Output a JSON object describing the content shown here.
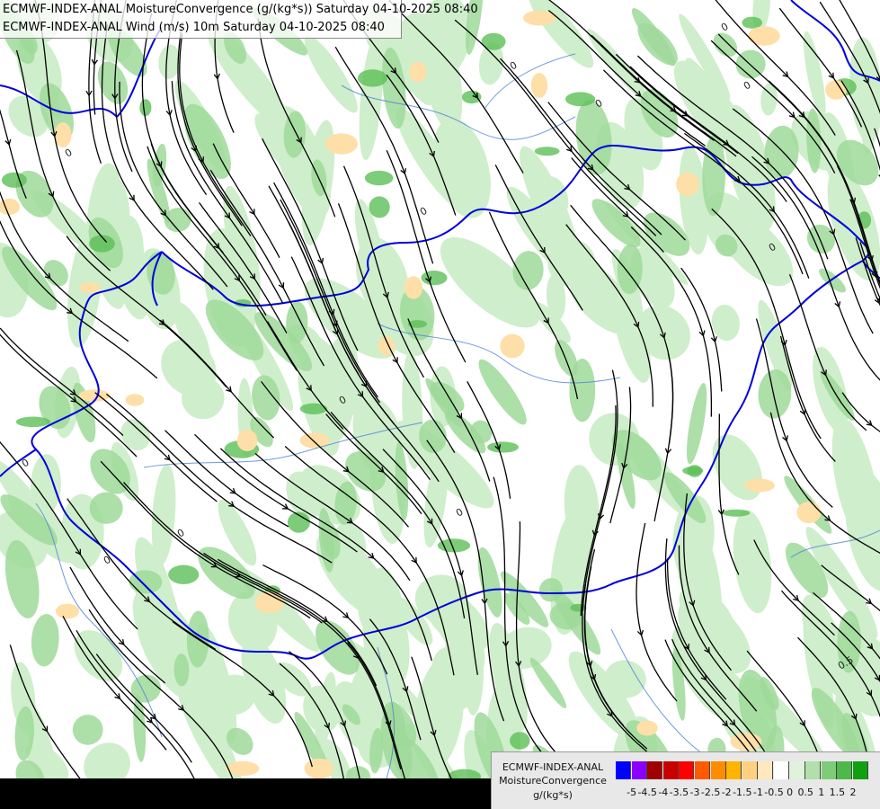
{
  "titles": {
    "line1": "ECMWF-INDEX-ANAL MoistureConvergence (g/(kg*s)) Saturday 04-10-2025 08:40",
    "line2": "ECMWF-INDEX-ANAL Wind (m/s) 10m Saturday 04-10-2025 08:40"
  },
  "legend": {
    "line1": "ECMWF-INDEX-ANAL",
    "line2": "MoistureConvergence",
    "line3": "g/(kg*s)",
    "colors": [
      "#0000ff",
      "#8a00ff",
      "#a00000",
      "#c80000",
      "#ff0000",
      "#ff5a00",
      "#ff8c00",
      "#ffb400",
      "#ffd080",
      "#ffe8c0",
      "#ffffff",
      "#dff2dc",
      "#b2e0ac",
      "#7fcc78",
      "#4eb84a",
      "#10a010"
    ],
    "ticks": [
      "-5",
      "-4.5",
      "-4",
      "-3.5",
      "-3",
      "-2.5",
      "-2",
      "-1.5",
      "-1",
      "-0.5",
      "0",
      "0.5",
      "1",
      "1.5",
      "2"
    ]
  },
  "map_labels": [
    "0",
    "0",
    "0",
    "0",
    "0",
    "0",
    "0",
    "0",
    "0",
    "0",
    "0",
    "0",
    "0.5"
  ],
  "palette": {
    "green_light": "#cfeecb",
    "green_mid": "#9fd99a",
    "green_dark": "#5cbf57",
    "orange_light": "#ffdfa8",
    "border": "#0000dd",
    "river": "#4a7fd6",
    "streamline": "#000000"
  }
}
